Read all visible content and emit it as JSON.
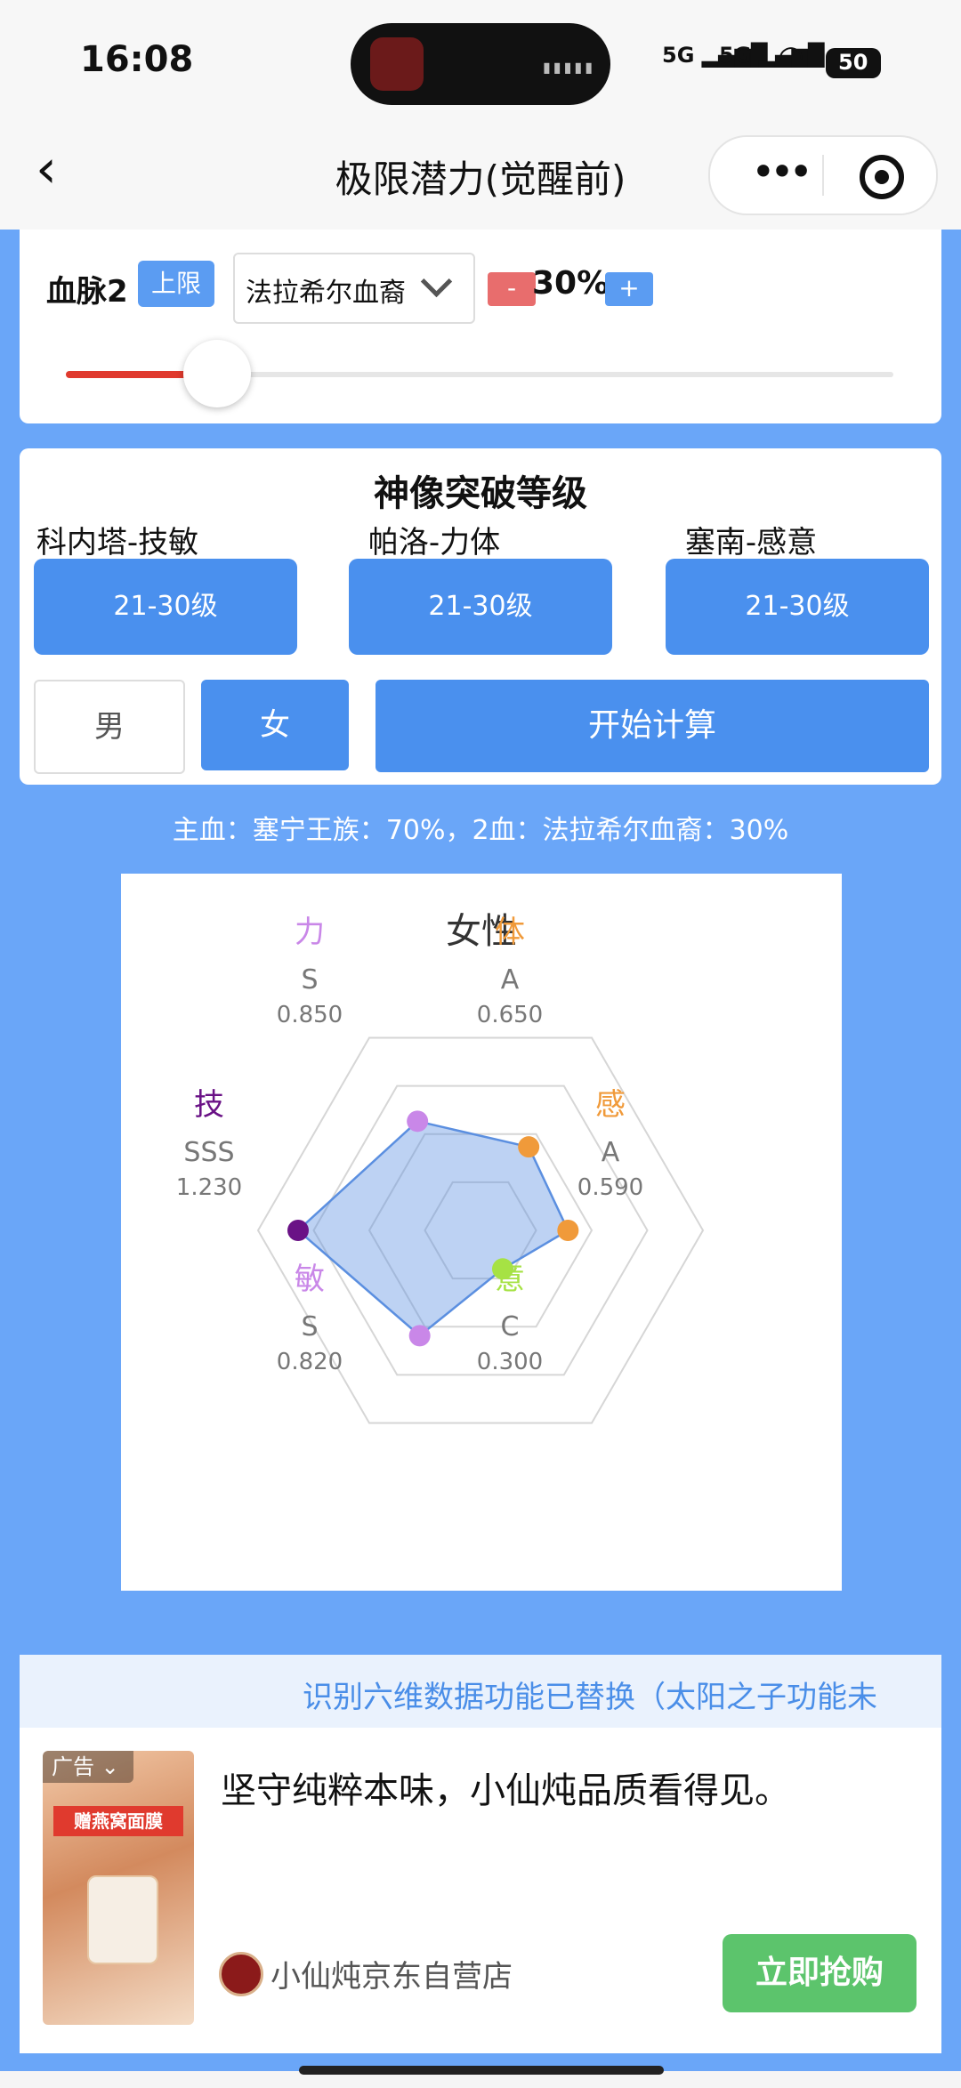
{
  "status_bar": {
    "time": "16:08",
    "signal1": "5G",
    "signal2": "5G",
    "battery": "50"
  },
  "nav": {
    "back_icon": "chevron-left",
    "title": "极限潜力(觉醒前)",
    "more_icon": "more-dots",
    "close_icon": "target"
  },
  "bloodline": {
    "label": "血脉2",
    "limit_button": "上限",
    "selected": "法拉希尔血裔",
    "minus": "-",
    "percent": "30%",
    "plus": "+",
    "slider_value": 0.3
  },
  "statue": {
    "title": "神像突破等级",
    "items": [
      {
        "name": "科内塔-技敏",
        "level": "21-30级"
      },
      {
        "name": "帕洛-力体",
        "level": "21-30级"
      },
      {
        "name": "塞南-感意",
        "level": "21-30级"
      }
    ],
    "gender_male": "男",
    "gender_female": "女",
    "selected_gender": "女",
    "calc_button": "开始计算"
  },
  "summary": "主血：塞宁王族：70%，2血：法拉希尔血裔：30%",
  "chart_data": {
    "type": "radar",
    "title": "女性",
    "axes": [
      {
        "name": "力",
        "grade": "S",
        "value": 0.85,
        "color": "#c987e8"
      },
      {
        "name": "体",
        "grade": "A",
        "value": 0.65,
        "color": "#f09a3a"
      },
      {
        "name": "感",
        "grade": "A",
        "value": 0.59,
        "color": "#f09a3a"
      },
      {
        "name": "意",
        "grade": "C",
        "value": 0.3,
        "color": "#a6e244"
      },
      {
        "name": "敏",
        "grade": "S",
        "value": 0.82,
        "color": "#c987e8"
      },
      {
        "name": "技",
        "grade": "SSS",
        "value": 1.23,
        "color": "#6a1286"
      }
    ],
    "value_labels": [
      "0.850",
      "0.650",
      "0.590",
      "0.300",
      "0.820",
      "1.230"
    ],
    "max": 1.5,
    "rings": 4,
    "fill_color": "#5b8fe0"
  },
  "notice": "识别六维数据功能已替换（太阳之子功能未",
  "ad": {
    "tag": "广告",
    "banner": "赠燕窝面膜",
    "headline": "坚守纯粹本味，小仙炖品质看得见。",
    "store": "小仙炖京东自营店",
    "cta": "立即抢购"
  }
}
